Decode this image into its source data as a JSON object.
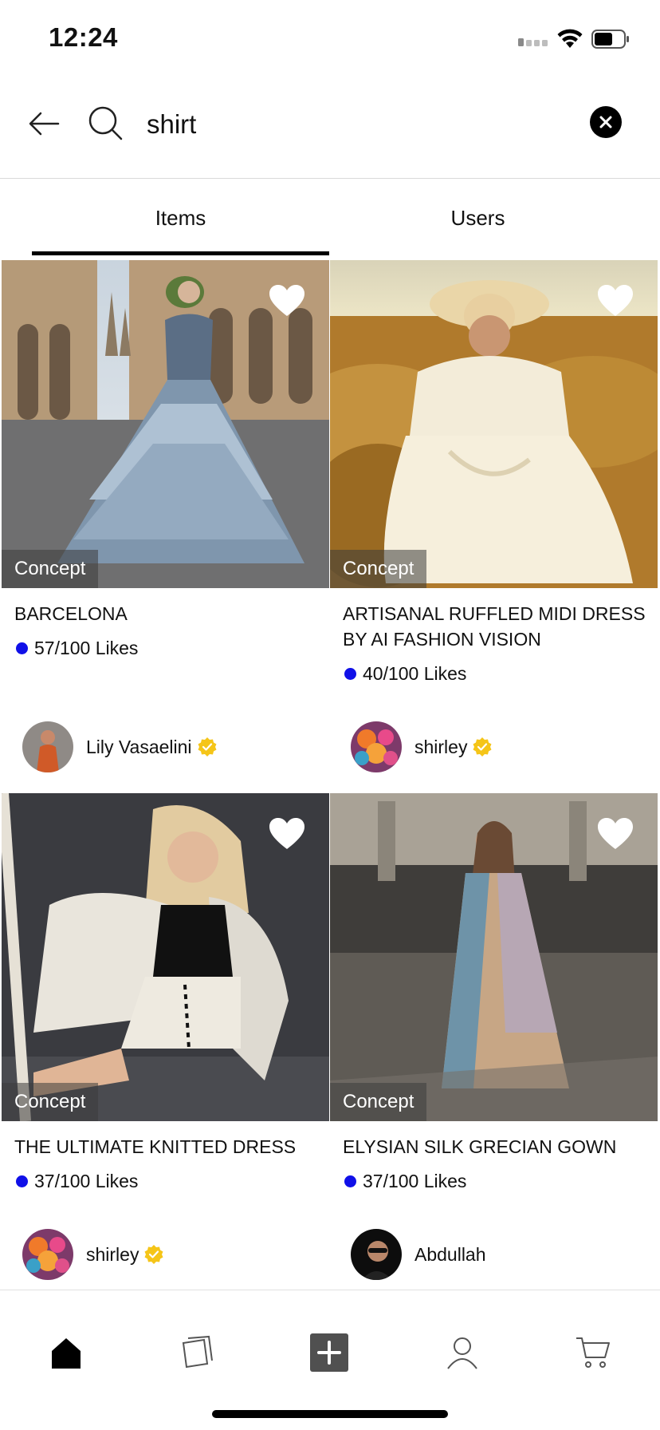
{
  "status_bar": {
    "time": "12:24"
  },
  "search": {
    "query": "shirt",
    "placeholder": ""
  },
  "tabs": [
    {
      "label": "Items",
      "active": true
    },
    {
      "label": "Users",
      "active": false
    }
  ],
  "products": [
    {
      "tag": "Concept",
      "title": "BARCELONA",
      "likes": "57/100 Likes",
      "author": "Lily Vasaelini",
      "verified": true
    },
    {
      "tag": "Concept",
      "title": "ARTISANAL RUFFLED MIDI DRESS BY AI FASHION VISION",
      "likes": "40/100 Likes",
      "author": "shirley",
      "verified": true
    },
    {
      "tag": "Concept",
      "title": "THE ULTIMATE KNITTED DRESS",
      "likes": "37/100 Likes",
      "author": "shirley",
      "verified": true
    },
    {
      "tag": "Concept",
      "title": "ELYSIAN SILK GRECIAN GOWN",
      "likes": "37/100 Likes",
      "author": "Abdullah",
      "verified": false
    }
  ],
  "bottom_nav": [
    {
      "icon": "home-icon",
      "active": true
    },
    {
      "icon": "collections-icon",
      "active": false
    },
    {
      "icon": "add-icon",
      "active": false
    },
    {
      "icon": "profile-icon",
      "active": false
    },
    {
      "icon": "cart-icon",
      "active": false
    }
  ],
  "colors": {
    "likes_dot": "#1010e8",
    "verified_badge": "#f5c518",
    "active_tab_indicator": "#000000"
  }
}
